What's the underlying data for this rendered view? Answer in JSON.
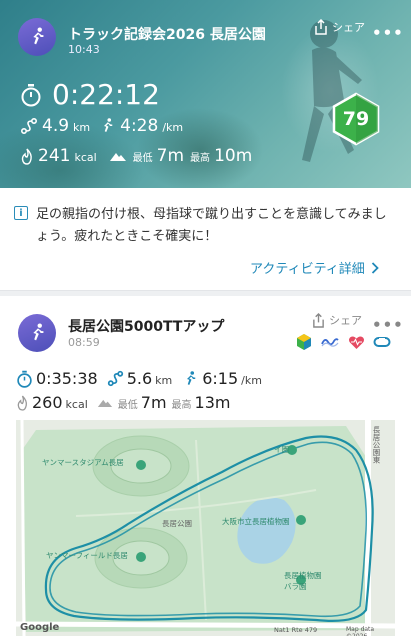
{
  "hero": {
    "title": "トラック記録会2026 長居公園",
    "time": "10:43",
    "share_label": "シェア",
    "more_label": "•••",
    "duration": "0:22:12",
    "distance_value": "4.9",
    "distance_unit": "km",
    "pace_value": "4:28",
    "pace_unit": "/km",
    "calories_value": "241",
    "calories_unit": "kcal",
    "elev_min_label": "最低",
    "elev_min_value": "7m",
    "elev_max_label": "最高",
    "elev_max_value": "10m",
    "score": "79"
  },
  "tip": {
    "icon_char": "i",
    "text": "足の親指の付け根、母指球で蹴り出すことを意識してみましょう。疲れたときこそ確実に！",
    "link_label": "アクティビティ詳細"
  },
  "activity": {
    "title": "長居公園5000TTアップ",
    "time": "08:59",
    "share_label": "シェア",
    "more_label": "•••",
    "duration": "0:35:38",
    "distance_value": "5.6",
    "distance_unit": "km",
    "pace_value": "6:15",
    "pace_unit": "/km",
    "calories_value": "260",
    "calories_unit": "kcal",
    "elev_min_label": "最低",
    "elev_min_value": "7m",
    "elev_max_label": "最高",
    "elev_max_value": "13m"
  },
  "map": {
    "labels": {
      "stadium": "ヤンマースタジアム長居",
      "field": "ヤンマーフィールド長居",
      "park": "長居公園",
      "botanical": "大阪市立長居植物園",
      "rose": "長居植物園\nバラ園",
      "station": "長居公園東",
      "nagai": "イ園",
      "route": "Nat1 Rte 479",
      "google": "Google",
      "copyright": "Map data ©2026"
    }
  },
  "colors": {
    "accent": "#1f88b8",
    "score_green": "#3cb14a",
    "route": "#1d8fa6",
    "avatar": "#5e55c4"
  }
}
